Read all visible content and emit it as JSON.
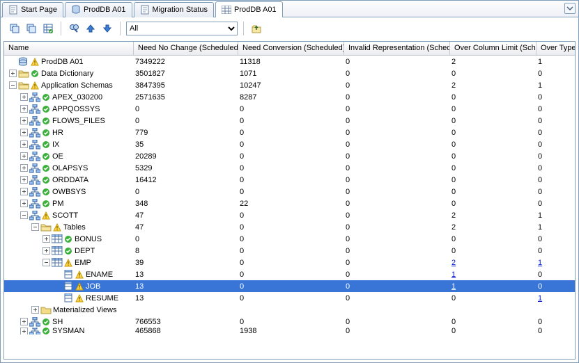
{
  "tabs": [
    {
      "label": "Start Page",
      "icon": "page"
    },
    {
      "label": "ProdDB A01",
      "icon": "db"
    },
    {
      "label": "Migration Status",
      "icon": "page"
    },
    {
      "label": "ProdDB A01",
      "icon": "grid",
      "active": true
    }
  ],
  "toolbar": {
    "filter_options": [
      "All"
    ],
    "filter_selected": "All"
  },
  "columns": [
    "Name",
    "Need No Change (Scheduled)",
    "Need Conversion (Scheduled)",
    "Invalid Representation (Scheduled)",
    "Over Column Limit (Scheduled)",
    "Over Type Limit (Scheduled)"
  ],
  "rows": [
    {
      "depth": 0,
      "toggle": "",
      "icon": "db",
      "status": "warn",
      "label": "ProdDB A01",
      "c": [
        "7349222",
        "11318",
        "0",
        "2",
        "1"
      ]
    },
    {
      "depth": 0,
      "toggle": "+",
      "icon": "folder",
      "status": "ok",
      "label": "Data Dictionary",
      "c": [
        "3501827",
        "1071",
        "0",
        "0",
        "0"
      ]
    },
    {
      "depth": 0,
      "toggle": "-",
      "icon": "folder",
      "status": "warn",
      "label": "Application Schemas",
      "c": [
        "3847395",
        "10247",
        "0",
        "2",
        "1"
      ]
    },
    {
      "depth": 1,
      "toggle": "+",
      "icon": "schema",
      "status": "ok",
      "label": "APEX_030200",
      "c": [
        "2571635",
        "8287",
        "0",
        "0",
        "0"
      ]
    },
    {
      "depth": 1,
      "toggle": "+",
      "icon": "schema",
      "status": "ok",
      "label": "APPQOSSYS",
      "c": [
        "0",
        "0",
        "0",
        "0",
        "0"
      ]
    },
    {
      "depth": 1,
      "toggle": "+",
      "icon": "schema",
      "status": "ok",
      "label": "FLOWS_FILES",
      "c": [
        "0",
        "0",
        "0",
        "0",
        "0"
      ]
    },
    {
      "depth": 1,
      "toggle": "+",
      "icon": "schema",
      "status": "ok",
      "label": "HR",
      "c": [
        "779",
        "0",
        "0",
        "0",
        "0"
      ]
    },
    {
      "depth": 1,
      "toggle": "+",
      "icon": "schema",
      "status": "ok",
      "label": "IX",
      "c": [
        "35",
        "0",
        "0",
        "0",
        "0"
      ]
    },
    {
      "depth": 1,
      "toggle": "+",
      "icon": "schema",
      "status": "ok",
      "label": "OE",
      "c": [
        "20289",
        "0",
        "0",
        "0",
        "0"
      ]
    },
    {
      "depth": 1,
      "toggle": "+",
      "icon": "schema",
      "status": "ok",
      "label": "OLAPSYS",
      "c": [
        "5329",
        "0",
        "0",
        "0",
        "0"
      ]
    },
    {
      "depth": 1,
      "toggle": "+",
      "icon": "schema",
      "status": "ok",
      "label": "ORDDATA",
      "c": [
        "16412",
        "0",
        "0",
        "0",
        "0"
      ]
    },
    {
      "depth": 1,
      "toggle": "+",
      "icon": "schema",
      "status": "ok",
      "label": "OWBSYS",
      "c": [
        "0",
        "0",
        "0",
        "0",
        "0"
      ]
    },
    {
      "depth": 1,
      "toggle": "+",
      "icon": "schema",
      "status": "ok",
      "label": "PM",
      "c": [
        "348",
        "22",
        "0",
        "0",
        "0"
      ]
    },
    {
      "depth": 1,
      "toggle": "-",
      "icon": "schema",
      "status": "warn",
      "label": "SCOTT",
      "c": [
        "47",
        "0",
        "0",
        "2",
        "1"
      ]
    },
    {
      "depth": 2,
      "toggle": "-",
      "icon": "folder",
      "status": "warn",
      "label": "Tables",
      "c": [
        "47",
        "0",
        "0",
        "2",
        "1"
      ]
    },
    {
      "depth": 3,
      "toggle": "+",
      "icon": "table",
      "status": "ok",
      "label": "BONUS",
      "c": [
        "0",
        "0",
        "0",
        "0",
        "0"
      ]
    },
    {
      "depth": 3,
      "toggle": "+",
      "icon": "table",
      "status": "ok",
      "label": "DEPT",
      "c": [
        "8",
        "0",
        "0",
        "0",
        "0"
      ]
    },
    {
      "depth": 3,
      "toggle": "-",
      "icon": "table",
      "status": "warn",
      "label": "EMP",
      "c": [
        "39",
        "0",
        "0",
        {
          "v": "2",
          "link": true
        },
        {
          "v": "1",
          "link": true
        }
      ]
    },
    {
      "depth": 4,
      "toggle": "",
      "icon": "col",
      "status": "warn",
      "label": "ENAME",
      "c": [
        "13",
        "0",
        "0",
        {
          "v": "1",
          "link": true
        },
        "0"
      ]
    },
    {
      "depth": 4,
      "toggle": "",
      "icon": "col",
      "status": "warn",
      "label": "JOB",
      "c": [
        "13",
        "0",
        "0",
        {
          "v": "1",
          "link": true
        },
        "0"
      ],
      "selected": true
    },
    {
      "depth": 4,
      "toggle": "",
      "icon": "col",
      "status": "warn",
      "label": "RESUME",
      "c": [
        "13",
        "0",
        "0",
        "0",
        {
          "v": "1",
          "link": true
        }
      ]
    },
    {
      "depth": 2,
      "toggle": "+",
      "icon": "folder-closed",
      "status": "",
      "label": "Materialized Views",
      "c": [
        "",
        "",
        "",
        "",
        ""
      ]
    },
    {
      "depth": 1,
      "toggle": "+",
      "icon": "schema",
      "status": "ok",
      "label": "SH",
      "c": [
        "766553",
        "0",
        "0",
        "0",
        "0"
      ]
    },
    {
      "depth": 1,
      "toggle": "+",
      "icon": "schema",
      "status": "ok",
      "label": "SYSMAN",
      "c": [
        "465868",
        "1938",
        "0",
        "0",
        "0"
      ],
      "cut": true
    }
  ]
}
